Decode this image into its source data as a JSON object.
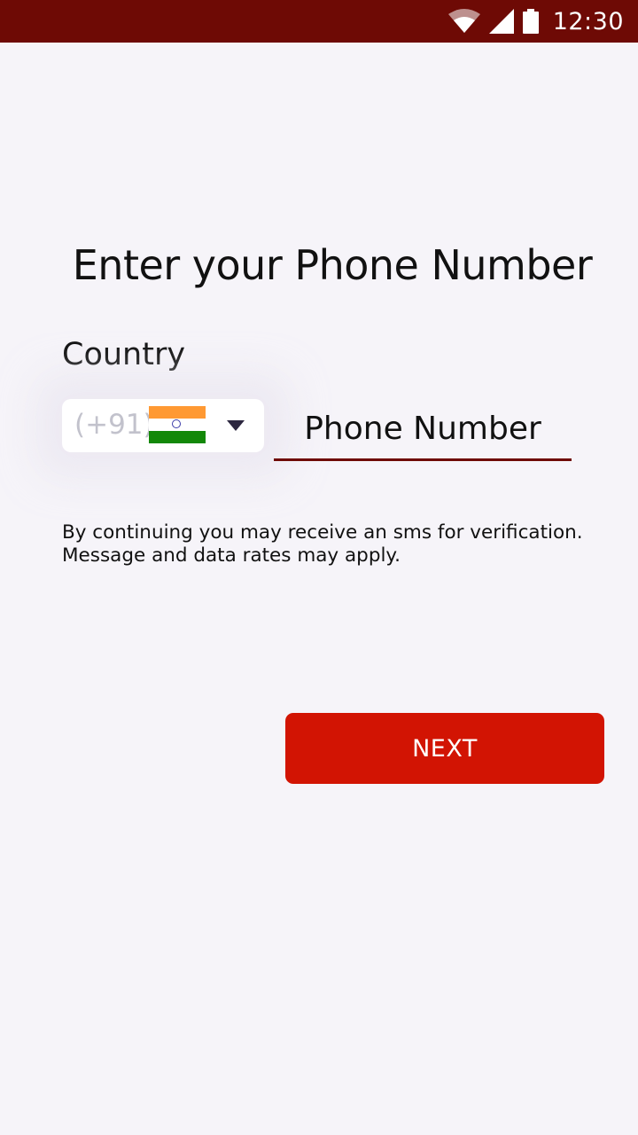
{
  "status_bar": {
    "time": "12:30",
    "icons": [
      "wifi-icon",
      "cell-signal-icon",
      "battery-icon"
    ],
    "background": "#6e0a05"
  },
  "main": {
    "title": "Enter your Phone Number",
    "country_label": "Country",
    "country_picker": {
      "dial_code": "(+91)",
      "flag": "india-flag-icon",
      "dropdown_icon": "caret-down-icon"
    },
    "phone_input": {
      "placeholder": "Phone Number",
      "value": ""
    },
    "disclaimer": "By continuing you may receive an sms for verification. Message and data rates may apply.",
    "next_label": "NEXT"
  },
  "colors": {
    "accent": "#d21403",
    "underline": "#6e0a05",
    "background": "#f6f4f9"
  }
}
